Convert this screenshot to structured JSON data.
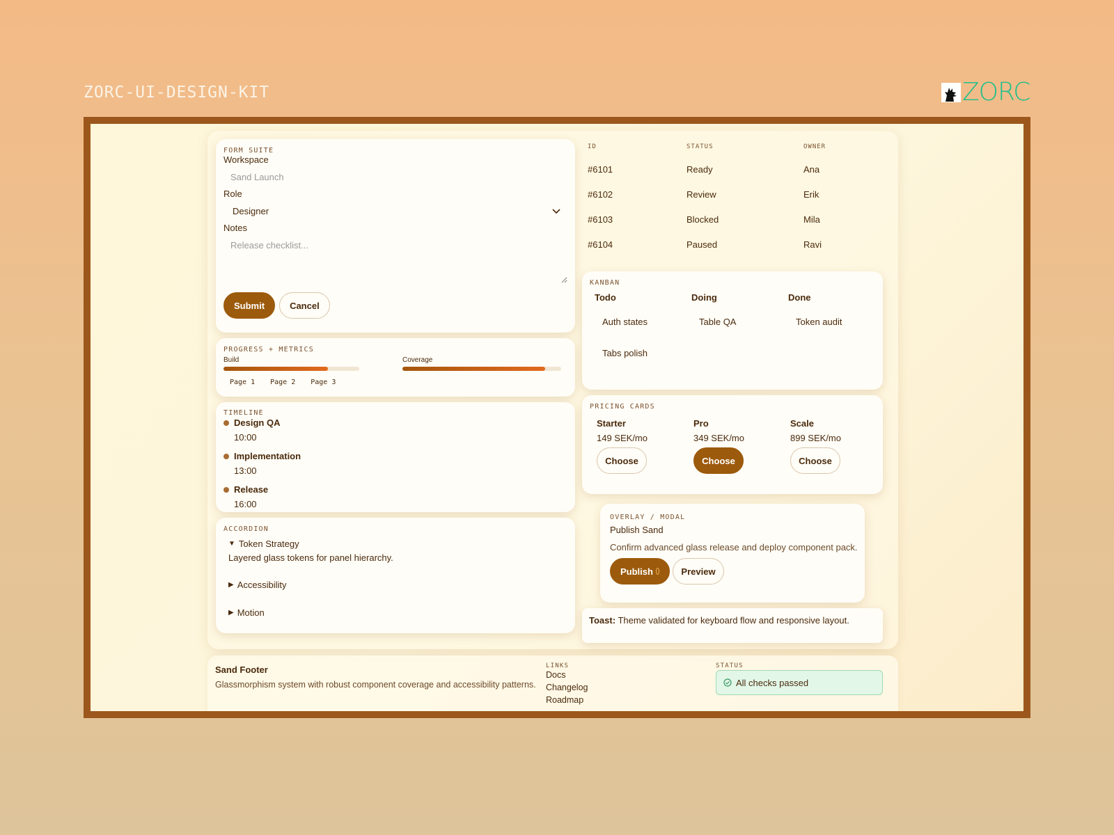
{
  "header": {
    "kit_title": "ZORC-UI-DESIGN-KIT",
    "brand_name": "ZORC",
    "brand_color": "#1fbf8a"
  },
  "form_suite": {
    "label": "FORM SUITE",
    "workspace_label": "Workspace",
    "workspace_placeholder": "Sand Launch",
    "role_label": "Role",
    "role_value": "Designer",
    "notes_label": "Notes",
    "notes_placeholder": "Release checklist...",
    "submit_label": "Submit",
    "cancel_label": "Cancel"
  },
  "progress": {
    "label": "PROGRESS + METRICS",
    "bars": [
      {
        "label": "Build",
        "fill": 0.77
      },
      {
        "label": "Coverage",
        "fill": 0.9
      }
    ],
    "pages": [
      "Page 1",
      "Page 2",
      "Page 3"
    ]
  },
  "timeline": {
    "label": "TIMELINE",
    "items": [
      {
        "title": "Design QA",
        "time": "10:00"
      },
      {
        "title": "Implementation",
        "time": "13:00"
      },
      {
        "title": "Release",
        "time": "16:00"
      }
    ]
  },
  "accordion": {
    "label": "ACCORDION",
    "items": [
      {
        "title": "Token Strategy",
        "open": true,
        "body": "Layered glass tokens for panel hierarchy."
      },
      {
        "title": "Accessibility",
        "open": false
      },
      {
        "title": "Motion",
        "open": false
      }
    ]
  },
  "table": {
    "headers": [
      "ID",
      "STATUS",
      "OWNER"
    ],
    "rows": [
      [
        "#6101",
        "Ready",
        "Ana"
      ],
      [
        "#6102",
        "Review",
        "Erik"
      ],
      [
        "#6103",
        "Blocked",
        "Mila"
      ],
      [
        "#6104",
        "Paused",
        "Ravi"
      ]
    ]
  },
  "kanban": {
    "label": "KANBAN",
    "columns": [
      {
        "title": "Todo",
        "cards": [
          "Auth states",
          "Tabs polish"
        ]
      },
      {
        "title": "Doing",
        "cards": [
          "Table QA"
        ]
      },
      {
        "title": "Done",
        "cards": [
          "Token audit"
        ]
      }
    ]
  },
  "pricing": {
    "label": "PRICING CARDS",
    "plans": [
      {
        "name": "Starter",
        "price": "149 SEK/mo",
        "cta": "Choose",
        "featured": false
      },
      {
        "name": "Pro",
        "price": "349 SEK/mo",
        "cta": "Choose",
        "featured": true
      },
      {
        "name": "Scale",
        "price": "899 SEK/mo",
        "cta": "Choose",
        "featured": false
      }
    ]
  },
  "modal": {
    "label": "OVERLAY / MODAL",
    "title": "Publish Sand",
    "body": "Confirm advanced glass release and deploy component pack.",
    "publish_label": "Publish",
    "preview_label": "Preview"
  },
  "toast": {
    "prefix": "Toast:",
    "message": "Theme validated for keyboard flow and responsive layout."
  },
  "footer": {
    "title": "Sand Footer",
    "description": "Glassmorphism system with robust component coverage and accessibility patterns.",
    "links_label": "LINKS",
    "links": [
      "Docs",
      "Changelog",
      "Roadmap"
    ],
    "status_label": "STATUS",
    "status_text": "All checks passed"
  }
}
